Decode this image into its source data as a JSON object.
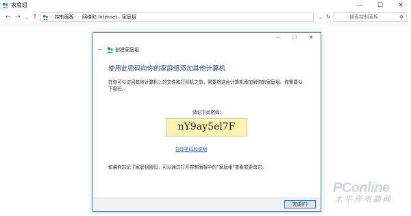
{
  "window": {
    "title": "家庭组",
    "minimize_glyph": "—",
    "maximize_glyph": "☐",
    "close_glyph": "✕"
  },
  "nav": {
    "back_glyph": "←",
    "forward_glyph": "→",
    "dropdown_glyph": "⌄",
    "up_glyph": "↑"
  },
  "address": {
    "breadcrumbs": [
      "控制面板",
      "网络和 Internet",
      "家庭组"
    ],
    "separator_glyph": "›",
    "dropdown_glyph": "⌄",
    "refresh_glyph": "↻"
  },
  "search": {
    "placeholder": "搜索控制面板",
    "search_glyph": "⚲"
  },
  "dialog": {
    "title": "创建家庭组",
    "back_glyph": "←",
    "minimize_glyph": "—",
    "maximize_glyph": "☐",
    "close_glyph": "✕",
    "heading": "使用此密码向你的家庭组添加其他计算机",
    "description": "在你可以访问其他计算机上的文件和打印机之前，需要将这台计算机添加到你的家庭组。你需要以下密码。",
    "password_label": "请记下此密码:",
    "password": "nY9ay5el7F",
    "print_link": "打印密码和说明",
    "footnote": "如果你忘记了家庭组密码，可以通过打开控制面板中的“家庭组”查看或更改它。",
    "finish_button": "完成(F)"
  },
  "watermark": {
    "brand": "PConline",
    "chinese": "太平洋电脑网"
  },
  "colors": {
    "heading": "#1e3fa8",
    "link": "#1a66cc",
    "password_bg": "#faf5b3",
    "dialog_border": "#4a88c9",
    "button_focus_border": "#0078d7",
    "homegroup_icon": "#1a8a6e"
  }
}
